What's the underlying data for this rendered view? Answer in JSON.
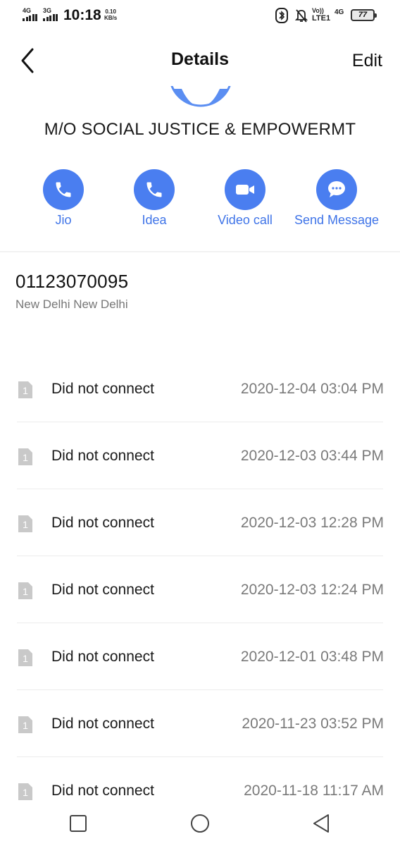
{
  "status_bar": {
    "sim1_network": "4G",
    "sim2_network": "3G",
    "time": "10:18",
    "speed_value": "0.10",
    "speed_unit": "KB/s",
    "volte_top": "Vo))",
    "volte_bottom": "LTE1",
    "network_right": "4G",
    "battery": "77"
  },
  "header": {
    "title": "Details",
    "edit_label": "Edit"
  },
  "contact": {
    "name": "M/O SOCIAL JUSTICE & EMPOWERMT",
    "number": "01123070095",
    "location": "New Delhi New Delhi"
  },
  "actions": [
    {
      "label": "Jio",
      "icon": "phone-icon"
    },
    {
      "label": "Idea",
      "icon": "phone-icon"
    },
    {
      "label": "Video call",
      "icon": "video-camera-icon"
    },
    {
      "label": "Send Message",
      "icon": "message-bubble-icon"
    }
  ],
  "call_log": [
    {
      "sim": "1",
      "status": "Did not connect",
      "time": "2020-12-04 03:04 PM"
    },
    {
      "sim": "1",
      "status": "Did not connect",
      "time": "2020-12-03 03:44 PM"
    },
    {
      "sim": "1",
      "status": "Did not connect",
      "time": "2020-12-03 12:28 PM"
    },
    {
      "sim": "1",
      "status": "Did not connect",
      "time": "2020-12-03 12:24 PM"
    },
    {
      "sim": "1",
      "status": "Did not connect",
      "time": "2020-12-01 03:48 PM"
    },
    {
      "sim": "1",
      "status": "Did not connect",
      "time": "2020-11-23 03:52 PM"
    },
    {
      "sim": "1",
      "status": "Did not connect",
      "time": "2020-11-18 11:17 AM"
    }
  ],
  "colors": {
    "accent": "#4a7ef0",
    "accent_text": "#3f74e8",
    "muted_text": "#7a7a7a"
  }
}
